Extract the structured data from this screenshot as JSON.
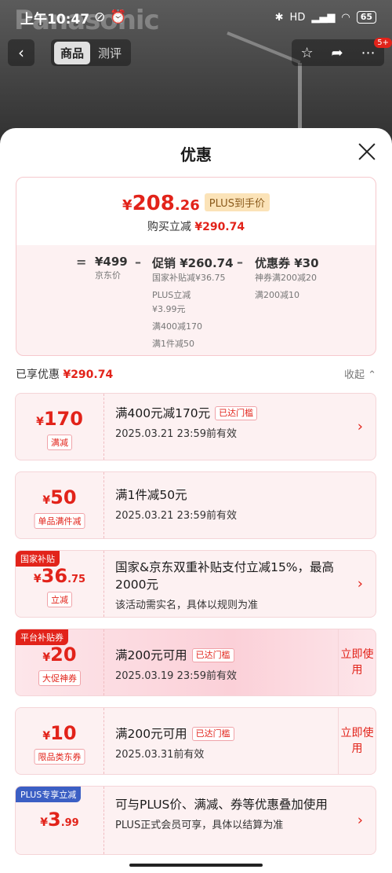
{
  "status_bar": {
    "time": "上午10:47",
    "battery": "65",
    "network": "HD"
  },
  "brand_text": "Panasonic",
  "nav": {
    "tabs": [
      "商品",
      "测评"
    ],
    "active_tab": "商品",
    "notification_count": "5+"
  },
  "sheet": {
    "title": "优惠"
  },
  "summary": {
    "currency": "¥",
    "final_price_int": "208",
    "final_price_dec": ".26",
    "plus_tag": "PLUS到手价",
    "reduce_label": "购买立减",
    "reduce_value": "¥290.74",
    "calc": {
      "equals": "=",
      "minus": "–",
      "jd_price": "¥499",
      "jd_price_label": "京东价",
      "promo": "促销 ¥260.74",
      "promo_details": [
        "国家补贴减¥36.75",
        "PLUS立减",
        "¥3.99元",
        "满400减170",
        "满1件减50"
      ],
      "coupon": "优惠券 ¥30",
      "coupon_details": [
        "神券满200减20",
        "满200减10"
      ]
    }
  },
  "enjoyed": {
    "label": "已享优惠",
    "value": "¥290.74",
    "collapse": "收起"
  },
  "cards": [
    {
      "cur": "¥",
      "num": "170",
      "dec": "",
      "tag": "满减",
      "badge": "",
      "title": "满400元减170元",
      "met": "已达门槛",
      "sub": "2025.03.21 23:59前有效",
      "action": "chevron"
    },
    {
      "cur": "¥",
      "num": "50",
      "dec": "",
      "tag": "单品满件减",
      "badge": "",
      "title": "满1件减50元",
      "met": "",
      "sub": "2025.03.21 23:59前有效",
      "action": ""
    },
    {
      "cur": "¥",
      "num": "36",
      "dec": ".75",
      "tag": "立减",
      "badge": "国家补贴",
      "title": "国家&京东双重补贴支付立减15%，最高2000元",
      "met": "",
      "sub": "该活动需实名，具体以规则为准",
      "action": "chevron"
    },
    {
      "cur": "¥",
      "num": "20",
      "dec": "",
      "tag": "大促神券",
      "badge": "平台补贴券",
      "title": "满200元可用",
      "met": "已达门槛",
      "sub": "2025.03.19 23:59前有效",
      "action": "立即使用"
    },
    {
      "cur": "¥",
      "num": "10",
      "dec": "",
      "tag": "限品类东券",
      "badge": "",
      "title": "满200元可用",
      "met": "已达门槛",
      "sub": "2025.03.31前有效",
      "action": "立即使用"
    },
    {
      "cur": "¥",
      "num": "3",
      "dec": ".99",
      "tag": "",
      "badge": "PLUS专享立减",
      "title": "可与PLUS价、满减、券等优惠叠加使用",
      "met": "",
      "sub": "PLUS正式会员可享，具体以结算为准",
      "action": "chevron"
    }
  ]
}
